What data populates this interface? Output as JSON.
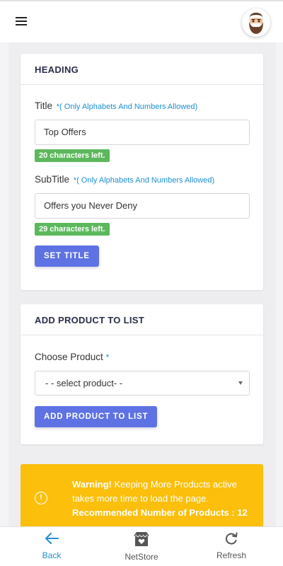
{
  "topbar": {
    "menu_icon": "hamburger-menu-icon",
    "avatar_icon": "bearded-man-avatar"
  },
  "heading_card": {
    "header": "HEADING",
    "title_label": "Title",
    "title_hint": "*( Only Alphabets And Numbers Allowed)",
    "title_value": "Top Offers",
    "title_chars_left": "20 characters left.",
    "subtitle_label": "SubTitle",
    "subtitle_hint": "*( Only Alphabets And Numbers Allowed)",
    "subtitle_value": "Offers you Never Deny",
    "subtitle_chars_left": "29 characters left.",
    "set_title_button": "SET TITLE"
  },
  "add_product_card": {
    "header": "ADD PRODUCT TO LIST",
    "choose_label": "Choose Product",
    "required_mark": "*",
    "select_value": "- - select product- -",
    "add_button": "ADD PRODUCT TO LIST"
  },
  "warning": {
    "icon": "info-circle-icon",
    "strong": "Warning!",
    "message": " Keeping More Products active takes more time to load the page.",
    "recommendation": "Recommended Number of Products : 12"
  },
  "bottom_nav": {
    "back_label": "Back",
    "netstore_label": "NetStore",
    "refresh_label": "Refresh"
  },
  "colors": {
    "accent": "#5e72e4",
    "hint": "#1e8fd3",
    "success": "#5cb85c",
    "warning": "#fbbf0c"
  }
}
